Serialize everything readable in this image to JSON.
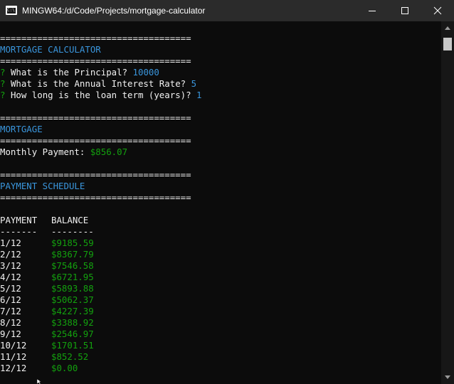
{
  "window": {
    "title": "MINGW64:/d/Code/Projects/mortgage-calculator",
    "icon": "terminal-app-icon",
    "icon_glyph": "C:\\"
  },
  "colors": {
    "background": "#0c0c0c",
    "titlebar": "#2b2b2b",
    "blue": "#3a96dd",
    "green": "#13a10e",
    "text": "#cccccc"
  },
  "terminal": {
    "separator": "====================================",
    "header_title": "MORTGAGE CALCULATOR",
    "prompt_mark": "?",
    "questions": [
      {
        "label": "What is the Principal?",
        "answer": "10000"
      },
      {
        "label": "What is the Annual Interest Rate?",
        "answer": "5"
      },
      {
        "label": "How long is the loan term (years)?",
        "answer": "1"
      }
    ],
    "mortgage_title": "MORTGAGE",
    "monthly_label": "Monthly Payment:",
    "monthly_value": "$856.07",
    "schedule_title": "PAYMENT SCHEDULE",
    "col_payment": "PAYMENT",
    "col_balance": "BALANCE",
    "underline_payment": "-------",
    "underline_balance": "--------",
    "rows": [
      {
        "payment": "1/12",
        "balance": "$9185.59"
      },
      {
        "payment": "2/12",
        "balance": "$8367.79"
      },
      {
        "payment": "3/12",
        "balance": "$7546.58"
      },
      {
        "payment": "4/12",
        "balance": "$6721.95"
      },
      {
        "payment": "5/12",
        "balance": "$5893.88"
      },
      {
        "payment": "6/12",
        "balance": "$5062.37"
      },
      {
        "payment": "7/12",
        "balance": "$4227.39"
      },
      {
        "payment": "8/12",
        "balance": "$3388.92"
      },
      {
        "payment": "9/12",
        "balance": "$2546.97"
      },
      {
        "payment": "10/12",
        "balance": "$1701.51"
      },
      {
        "payment": "11/12",
        "balance": "$852.52"
      },
      {
        "payment": "12/12",
        "balance": "$0.00"
      }
    ]
  }
}
